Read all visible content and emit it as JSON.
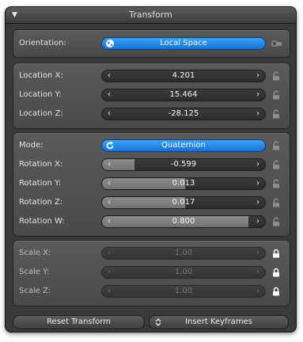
{
  "panel": {
    "title": "Transform"
  },
  "orientation": {
    "label": "Orientation:",
    "value": "Local Space"
  },
  "location": [
    {
      "label": "Location X:",
      "value": "4.201"
    },
    {
      "label": "Location Y:",
      "value": "15.464"
    },
    {
      "label": "Location Z:",
      "value": "-28.125"
    }
  ],
  "rotation_mode": {
    "label": "Mode:",
    "value": "Quaternion"
  },
  "rotation": [
    {
      "label": "Rotation X:",
      "value": "-0.599",
      "fill": 0.2
    },
    {
      "label": "Rotation Y:",
      "value": "0.013",
      "fill": 0.51
    },
    {
      "label": "Rotation Z:",
      "value": "0.017",
      "fill": 0.51
    },
    {
      "label": "Rotation W:",
      "value": "0.800",
      "fill": 0.9
    }
  ],
  "scale": [
    {
      "label": "Scale X:",
      "value": "1.00"
    },
    {
      "label": "Scale Y:",
      "value": "1.00"
    },
    {
      "label": "Scale Z:",
      "value": "1.00"
    }
  ],
  "buttons": {
    "reset": "Reset Transform",
    "insert": "Insert Keyframes"
  },
  "colors": {
    "accent": "#1f86e8",
    "panel_bg": "#3a3a3a",
    "field_bg": "#2f2f2f",
    "slider_fill": "#808080"
  },
  "icons": {
    "collapse": "triangle-down-icon",
    "orientation": "globe-icon",
    "orientation_side": "link-icon",
    "mode": "refresh-icon",
    "unlocked": "unlocked-padlock-icon",
    "locked": "locked-padlock-icon",
    "insert": "up-down-arrows-icon"
  }
}
